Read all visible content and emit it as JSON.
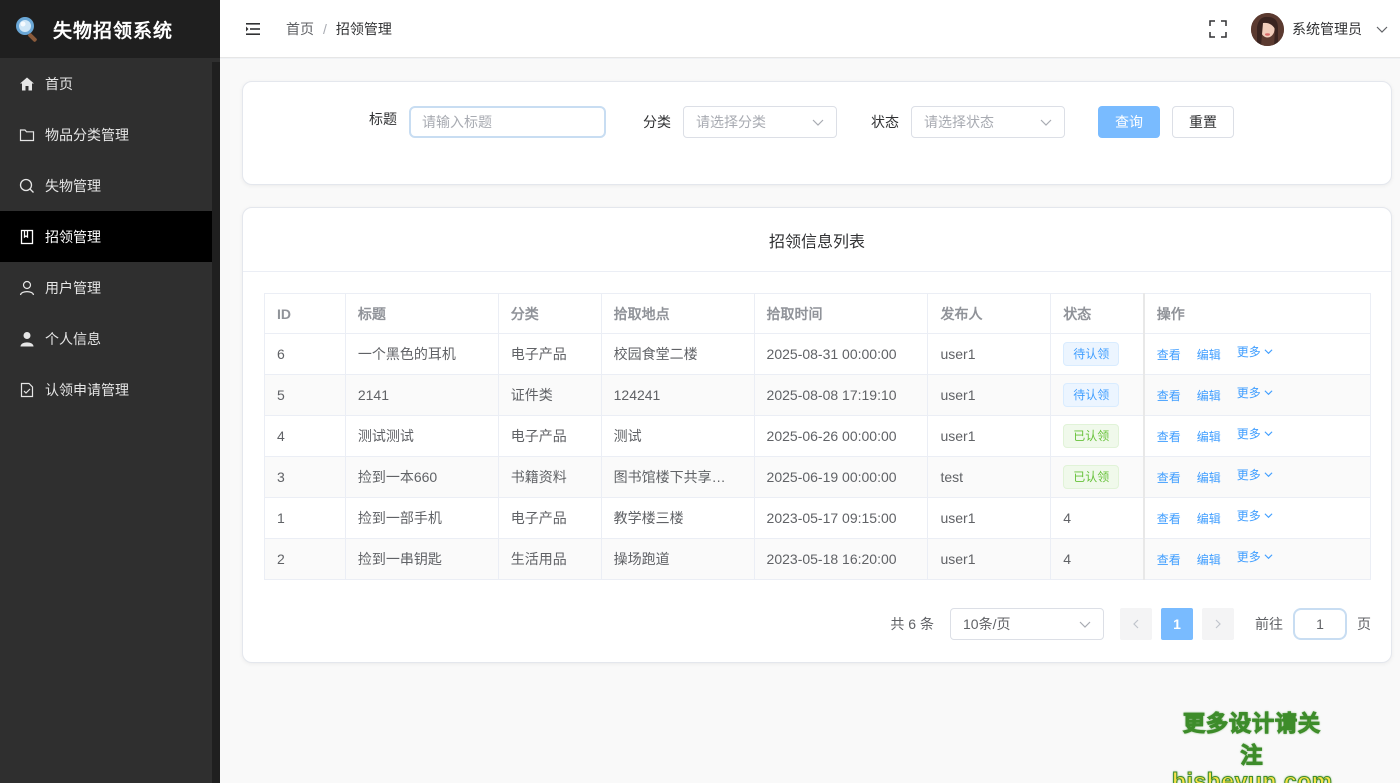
{
  "app": {
    "title": "失物招领系统"
  },
  "sidebar": {
    "items": [
      {
        "label": "首页",
        "icon": "home-icon"
      },
      {
        "label": "物品分类管理",
        "icon": "folder-icon"
      },
      {
        "label": "失物管理",
        "icon": "search-icon"
      },
      {
        "label": "招领管理",
        "icon": "notebook-icon",
        "active": true
      },
      {
        "label": "用户管理",
        "icon": "user-icon"
      },
      {
        "label": "个人信息",
        "icon": "avatar-icon"
      },
      {
        "label": "认领申请管理",
        "icon": "document-check-icon"
      }
    ]
  },
  "header": {
    "breadcrumb": {
      "home": "首页",
      "separator": "/",
      "current": "招领管理"
    },
    "username": "系统管理员"
  },
  "search": {
    "title_label": "标题",
    "title_placeholder": "请输入标题",
    "category_label": "分类",
    "category_placeholder": "请选择分类",
    "status_label": "状态",
    "status_placeholder": "请选择状态",
    "query_button": "查询",
    "reset_button": "重置"
  },
  "list": {
    "title": "招领信息列表",
    "columns": [
      "ID",
      "标题",
      "分类",
      "拾取地点",
      "拾取时间",
      "发布人",
      "状态",
      "操作"
    ],
    "rows": [
      {
        "id": "6",
        "title": "一个黑色的耳机",
        "category": "电子产品",
        "location": "校园食堂二楼",
        "time": "2025-08-31 00:00:00",
        "publisher": "user1",
        "status": "待认领",
        "status_type": "pending"
      },
      {
        "id": "5",
        "title": "2141",
        "category": "证件类",
        "location": "124241",
        "time": "2025-08-08 17:19:10",
        "publisher": "user1",
        "status": "待认领",
        "status_type": "pending"
      },
      {
        "id": "4",
        "title": "测试测试",
        "category": "电子产品",
        "location": "测试",
        "time": "2025-06-26 00:00:00",
        "publisher": "user1",
        "status": "已认领",
        "status_type": "done"
      },
      {
        "id": "3",
        "title": "捡到一本660",
        "category": "书籍资料",
        "location": "图书馆楼下共享…",
        "time": "2025-06-19 00:00:00",
        "publisher": "test",
        "status": "已认领",
        "status_type": "done"
      },
      {
        "id": "1",
        "title": "捡到一部手机",
        "category": "电子产品",
        "location": "教学楼三楼",
        "time": "2023-05-17 09:15:00",
        "publisher": "user1",
        "status": "4",
        "status_type": "plain"
      },
      {
        "id": "2",
        "title": "捡到一串钥匙",
        "category": "生活用品",
        "location": "操场跑道",
        "time": "2023-05-18 16:20:00",
        "publisher": "user1",
        "status": "4",
        "status_type": "plain"
      }
    ],
    "actions": {
      "view": "查看",
      "edit": "编辑",
      "more": "更多"
    }
  },
  "pagination": {
    "total_text": "共 6 条",
    "page_size": "10条/页",
    "current_page": "1",
    "goto_label": "前往",
    "goto_value": "1",
    "page_suffix": "页"
  },
  "watermark": {
    "line1": "更多设计请关注",
    "line2": "bisheyun.com"
  },
  "colors": {
    "sidebar_bg": "#2f2f2f",
    "active_bg": "#000000",
    "primary": "#409eff",
    "primary_light": "#79bbff",
    "success": "#67c23a"
  }
}
